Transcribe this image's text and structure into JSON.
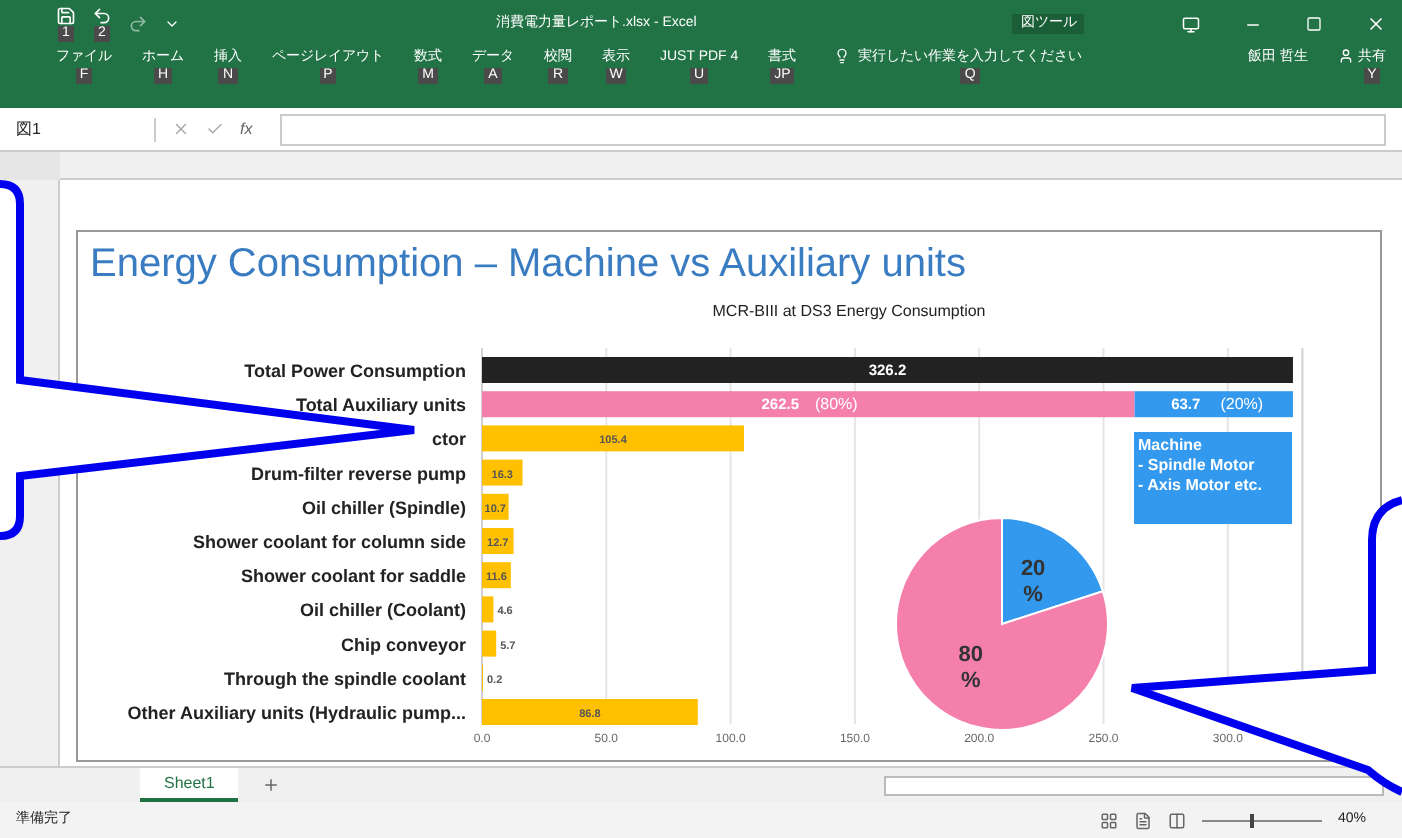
{
  "window": {
    "title": "消費電力量レポート.xlsx - Excel",
    "context_tab": "図ツール",
    "quick_access_tips": [
      "1",
      "2"
    ]
  },
  "ribbon": {
    "tabs": [
      {
        "label": "ファイル",
        "tip": "F",
        "selected": false
      },
      {
        "label": "ホーム",
        "tip": "H",
        "selected": false
      },
      {
        "label": "挿入",
        "tip": "N",
        "selected": false
      },
      {
        "label": "ページレイアウト",
        "tip": "P",
        "selected": false
      },
      {
        "label": "数式",
        "tip": "M",
        "selected": false
      },
      {
        "label": "データ",
        "tip": "A",
        "selected": false
      },
      {
        "label": "校閲",
        "tip": "R",
        "selected": false
      },
      {
        "label": "表示",
        "tip": "W",
        "selected": false
      },
      {
        "label": "JUST PDF 4",
        "tip": "U",
        "selected": false
      },
      {
        "label": "書式",
        "tip": "JP",
        "selected": false
      }
    ],
    "tell_me": {
      "placeholder": "実行したい作業を入力してください",
      "tip": "Q"
    },
    "user": "飯田 哲生",
    "share": {
      "label": "共有",
      "tip": "Y"
    }
  },
  "formula_bar": {
    "name_box": "図1",
    "function_label": "fx"
  },
  "chart": {
    "title": "Energy Consumption – Machine vs Auxiliary units",
    "subtitle": "MCR-BIII at DS3 Energy Consumption",
    "share_labels": [
      "(80%)",
      "(20%)"
    ],
    "note": [
      "Machine",
      "- Spindle Motor",
      "- Axis Motor etc."
    ],
    "chart_data": {
      "type": "bar",
      "orientation": "horizontal",
      "stacked": true,
      "data_labels": true,
      "grid": true,
      "categories": [
        "Total Power Consumption",
        "Total Auxiliary units",
        "ctor",
        "Drum-filter reverse pump",
        "Oil chiller (Spindle)",
        "Shower coolant for column side",
        "Shower coolant for saddle",
        "Oil chiller (Coolant)",
        "Chip conveyor",
        "Through the spindle coolant",
        "Other Auxiliary units (Hydraulic pump..."
      ],
      "series": [
        {
          "color": "#222222",
          "values": [
            326.2,
            null,
            null,
            null,
            null,
            null,
            null,
            null,
            null,
            null,
            null
          ]
        },
        {
          "color": "#f57fab",
          "values": [
            null,
            262.5,
            null,
            null,
            null,
            null,
            null,
            null,
            null,
            null,
            null
          ]
        },
        {
          "color": "#3399ee",
          "values": [
            null,
            63.7,
            null,
            null,
            null,
            null,
            null,
            null,
            null,
            null,
            null
          ]
        },
        {
          "color": "#ffc000",
          "values": [
            null,
            null,
            105.4,
            16.3,
            10.7,
            12.7,
            11.6,
            4.6,
            5.7,
            0.2,
            86.8
          ]
        }
      ],
      "xlim": [
        0,
        330
      ],
      "xticks": [
        {
          "value": 0,
          "label": "0.0"
        },
        {
          "value": 50,
          "label": "50.0"
        },
        {
          "value": 100,
          "label": "100.0"
        },
        {
          "value": 150,
          "label": "150.0"
        },
        {
          "value": 200,
          "label": "200.0"
        },
        {
          "value": 250,
          "label": "250.0"
        },
        {
          "value": 300,
          "label": "300.0"
        }
      ]
    },
    "pie": {
      "chart_data": {
        "type": "pie",
        "values": [
          20,
          80
        ],
        "colors": [
          "#3399ee",
          "#f57fab"
        ],
        "value_labels": [
          "20\n%",
          "80\n%"
        ]
      }
    }
  },
  "sheet_tabs": [
    {
      "label": "Sheet1",
      "selected": true
    }
  ],
  "status_bar": {
    "text": "準備完了",
    "zoom_slider": {
      "level": 0.4
    },
    "zoom": "40%"
  }
}
